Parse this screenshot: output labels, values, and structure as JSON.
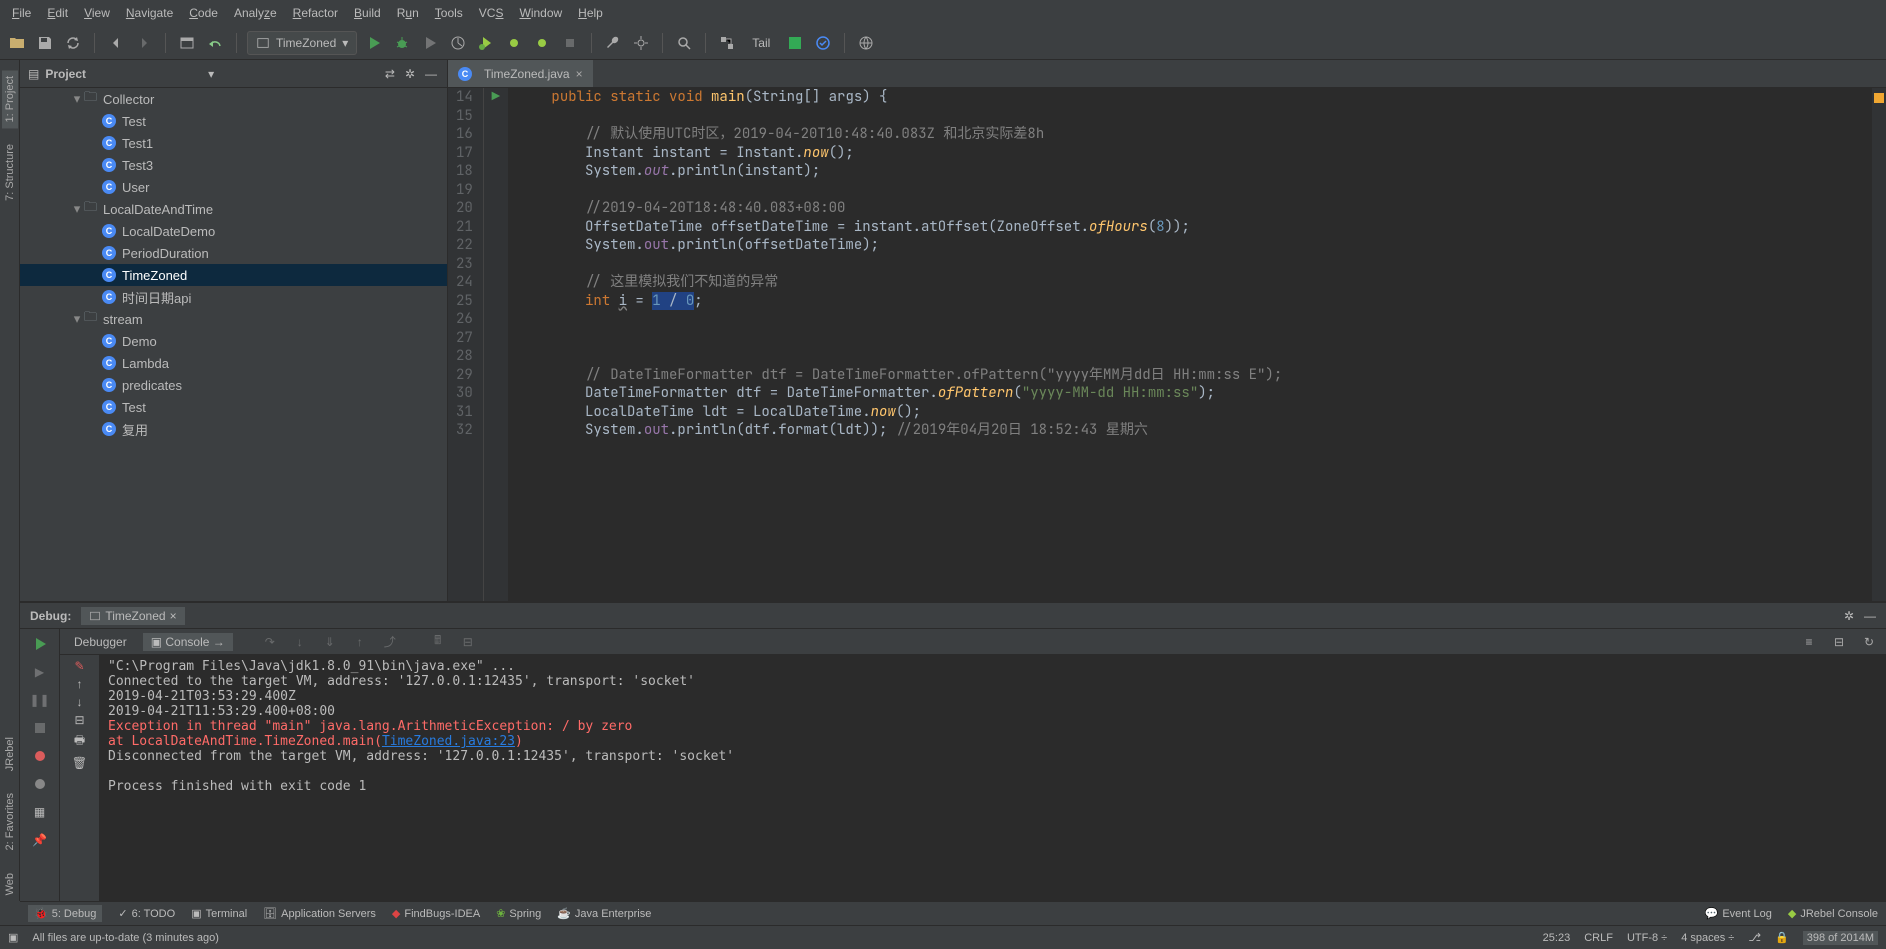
{
  "menu": [
    "File",
    "Edit",
    "View",
    "Navigate",
    "Code",
    "Analyze",
    "Refactor",
    "Build",
    "Run",
    "Tools",
    "VCS",
    "Window",
    "Help"
  ],
  "runConfig": "TimeZoned",
  "tailLabel": "Tail",
  "projectPanel": {
    "title": "Project"
  },
  "tree": [
    {
      "depth": 0,
      "expand": "▾",
      "type": "folder",
      "label": "Collector"
    },
    {
      "depth": 1,
      "expand": "",
      "type": "class",
      "label": "Test"
    },
    {
      "depth": 1,
      "expand": "",
      "type": "class",
      "label": "Test1"
    },
    {
      "depth": 1,
      "expand": "",
      "type": "class",
      "label": "Test3"
    },
    {
      "depth": 1,
      "expand": "",
      "type": "class",
      "label": "User"
    },
    {
      "depth": 0,
      "expand": "▾",
      "type": "folder",
      "label": "LocalDateAndTime"
    },
    {
      "depth": 1,
      "expand": "",
      "type": "class",
      "label": "LocalDateDemo"
    },
    {
      "depth": 1,
      "expand": "",
      "type": "class",
      "label": "PeriodDuration"
    },
    {
      "depth": 1,
      "expand": "",
      "type": "class",
      "label": "TimeZoned",
      "selected": true
    },
    {
      "depth": 1,
      "expand": "",
      "type": "class",
      "label": "时间日期api"
    },
    {
      "depth": 0,
      "expand": "▾",
      "type": "folder",
      "label": "stream"
    },
    {
      "depth": 1,
      "expand": "",
      "type": "class",
      "label": "Demo"
    },
    {
      "depth": 1,
      "expand": "",
      "type": "class",
      "label": "Lambda"
    },
    {
      "depth": 1,
      "expand": "",
      "type": "class",
      "label": "predicates"
    },
    {
      "depth": 1,
      "expand": "",
      "type": "class",
      "label": "Test"
    },
    {
      "depth": 1,
      "expand": "",
      "type": "class",
      "label": "复用"
    }
  ],
  "editorTab": "TimeZoned.java",
  "lines": [
    14,
    15,
    16,
    17,
    18,
    19,
    20,
    21,
    22,
    23,
    24,
    25,
    26,
    27,
    28,
    29,
    30,
    31,
    32
  ],
  "code": {
    "l14": "public static void main(String[] args) {",
    "l16": "// 默认使用UTC时区，2019-04-20T10:48:40.083Z 和北京实际差8h",
    "l17": "Instant instant = Instant.now();",
    "l18": "System.out.println(instant);",
    "l20": "//2019-04-20T18:48:40.083+08:00",
    "l21": "OffsetDateTime offsetDateTime = instant.atOffset(ZoneOffset.ofHours(8));",
    "l22": "System.out.println(offsetDateTime);",
    "l24": "// 这里模拟我们不知道的异常",
    "l25": "int i = 1 / 0;",
    "l29": "// DateTimeFormatter dtf = DateTimeFormatter.ofPattern(\"yyyy年MM月dd日 HH:mm:ss E\");",
    "l30": "DateTimeFormatter dtf = DateTimeFormatter.ofPattern(\"yyyy-MM-dd HH:mm:ss\");",
    "l31": "LocalDateTime ldt = LocalDateTime.now();",
    "l32": "System.out.println(dtf.format(ldt)); //2019年04月20日 18:52:43 星期六"
  },
  "debug": {
    "label": "Debug:",
    "config": "TimeZoned",
    "tabDebugger": "Debugger",
    "tabConsole": "Console"
  },
  "console": {
    "l1": "\"C:\\Program Files\\Java\\jdk1.8.0_91\\bin\\java.exe\" ...",
    "l2": "Connected to the target VM, address: '127.0.0.1:12435', transport: 'socket'",
    "l3": "2019-04-21T03:53:29.400Z",
    "l4": "2019-04-21T11:53:29.400+08:00",
    "l5": "Exception in thread \"main\" java.lang.ArithmeticException: / by zero",
    "l6a": "\tat LocalDateAndTime.TimeZoned.main(",
    "l6b": "TimeZoned.java:23",
    "l6c": ")",
    "l7": "Disconnected from the target VM, address: '127.0.0.1:12435', transport: 'socket'",
    "l8": "Process finished with exit code 1"
  },
  "bottomTabs": {
    "debug": "5: Debug",
    "todo": "6: TODO",
    "terminal": "Terminal",
    "appServers": "Application Servers",
    "findbugs": "FindBugs-IDEA",
    "spring": "Spring",
    "javaee": "Java Enterprise",
    "eventLog": "Event Log",
    "jrebel": "JRebel Console"
  },
  "status": {
    "msg": "All files are up-to-date (3 minutes ago)",
    "pos": "25:23",
    "crlf": "CRLF",
    "enc": "UTF-8",
    "indent": "4 spaces",
    "branch": "",
    "mem": "398 of 2014M"
  },
  "leftTabs": {
    "project": "1: Project",
    "structure": "7: Structure",
    "favorites": "2: Favorites",
    "jrebel": "JRebel",
    "web": "Web"
  }
}
